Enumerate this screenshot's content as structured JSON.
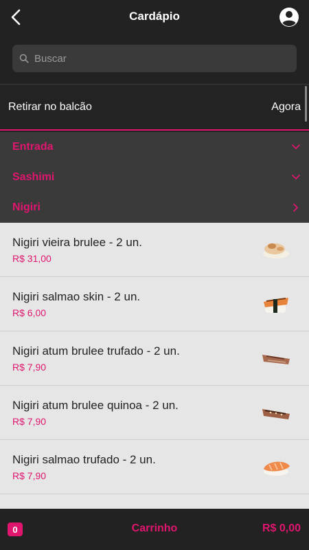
{
  "header": {
    "title": "Cardápio",
    "back_icon": "chevron-left-icon",
    "profile_icon": "account-circle-icon"
  },
  "search": {
    "placeholder": "Buscar",
    "value": "",
    "icon": "search-icon"
  },
  "pickup": {
    "label": "Retirar no balcão",
    "time": "Agora"
  },
  "categories": [
    {
      "label": "Entrada",
      "state": "expanded",
      "icon": "chevron-down-icon"
    },
    {
      "label": "Sashimi",
      "state": "expanded",
      "icon": "chevron-down-icon"
    },
    {
      "label": "Nigiri",
      "state": "collapsed",
      "icon": "chevron-right-icon"
    }
  ],
  "products": [
    {
      "name": "Nigiri vieira brulee - 2 un.",
      "price": "R$ 31,00"
    },
    {
      "name": "Nigiri salmao skin - 2 un.",
      "price": "R$ 6,00"
    },
    {
      "name": "Nigiri atum brulee trufado - 2 un.",
      "price": "R$ 7,90"
    },
    {
      "name": "Nigiri atum brulee quinoa - 2 un.",
      "price": "R$ 7,90"
    },
    {
      "name": "Nigiri salmao trufado - 2 un.",
      "price": "R$ 7,90"
    }
  ],
  "cart": {
    "count": "0",
    "label": "Carrinho",
    "total": "R$ 0,00"
  },
  "colors": {
    "accent": "#e0156e",
    "background": "#222222",
    "list_background": "#e6e6e6"
  }
}
